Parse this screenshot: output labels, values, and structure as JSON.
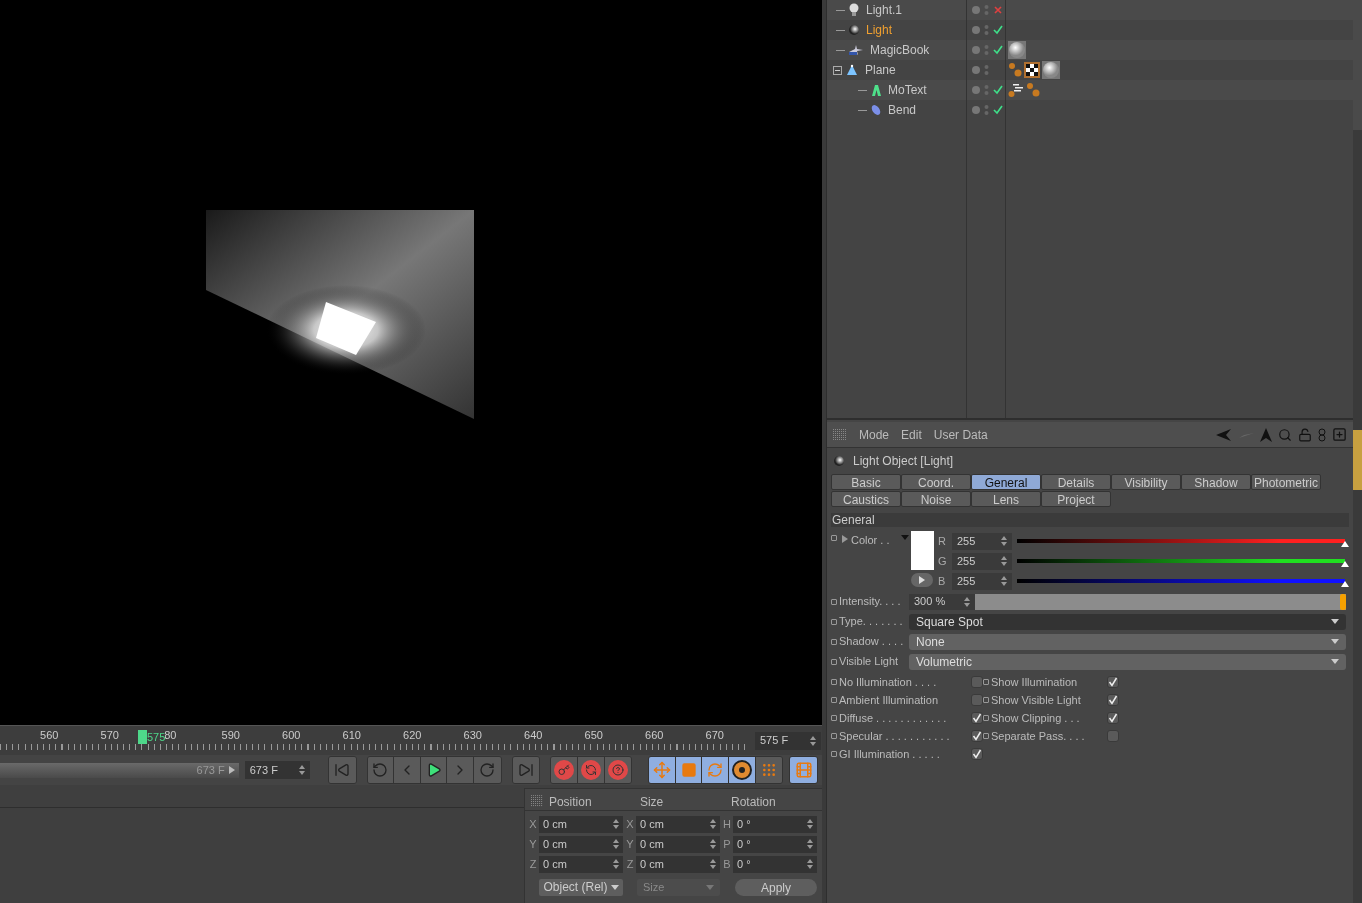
{
  "objects": [
    {
      "name": "Light.1",
      "kind": "bulb",
      "active": false,
      "enabled": false
    },
    {
      "name": "Light",
      "kind": "spot",
      "active": true,
      "enabled": true
    },
    {
      "name": "MagicBook",
      "kind": "figure",
      "active": false,
      "enabled": true,
      "tags": [
        {
          "kind": "material"
        }
      ]
    },
    {
      "name": "Plane",
      "kind": "plane",
      "active": false,
      "expanded": true,
      "tags": [
        {
          "kind": "dots"
        },
        {
          "kind": "checker"
        },
        {
          "kind": "material"
        }
      ],
      "children": [
        {
          "name": "MoText",
          "kind": "motext",
          "active": false,
          "enabled": true,
          "tags": [
            {
              "kind": "lines"
            },
            {
              "kind": "dots"
            }
          ]
        },
        {
          "name": "Bend",
          "kind": "bend",
          "active": false,
          "enabled": true
        }
      ]
    }
  ],
  "attributes": {
    "menu": [
      "Mode",
      "Edit",
      "User Data"
    ],
    "title": "Light Object [Light]",
    "tabs": [
      {
        "label": "Basic",
        "selected": false
      },
      {
        "label": "Coord.",
        "selected": false
      },
      {
        "label": "General",
        "selected": true
      },
      {
        "label": "Details",
        "selected": false
      },
      {
        "label": "Visibility",
        "selected": false
      },
      {
        "label": "Shadow",
        "selected": false
      },
      {
        "label": "Photometric",
        "selected": false
      },
      {
        "label": "Caustics",
        "selected": false
      },
      {
        "label": "Noise",
        "selected": false
      },
      {
        "label": "Lens",
        "selected": false
      },
      {
        "label": "Project",
        "selected": false
      }
    ],
    "section": "General",
    "color": {
      "label": "Color . .",
      "channels": [
        {
          "name": "R",
          "value": "255",
          "level": 1,
          "color": "#ff2020"
        },
        {
          "name": "G",
          "value": "255",
          "level": 1,
          "color": "#20e020"
        },
        {
          "name": "B",
          "value": "255",
          "level": 1,
          "color": "#1010ff"
        }
      ]
    },
    "params": [
      {
        "kind": "slider",
        "label": "Intensity. . . .",
        "value": "300 %",
        "level": 1
      },
      {
        "kind": "dropdown",
        "label": "Type. . . . . . .",
        "value": "Square Spot",
        "focused": true
      },
      {
        "kind": "dropdown",
        "label": "Shadow . . . .",
        "value": "None",
        "focused": false
      },
      {
        "kind": "dropdown",
        "label": "Visible Light",
        "value": "Volumetric",
        "focused": false
      }
    ],
    "options_left": [
      {
        "label": "No Illumination . . . .",
        "checked": false
      },
      {
        "label": "Ambient Illumination",
        "checked": false
      },
      {
        "label": "Diffuse . . . . . . . . . . . .",
        "checked": true
      },
      {
        "label": "Specular . . . . . . . . . . .",
        "checked": true
      },
      {
        "label": "GI Illumination . . . . .",
        "checked": true
      }
    ],
    "options_right": [
      {
        "label": "Show Illumination",
        "checked": true
      },
      {
        "label": "Show Visible Light",
        "checked": true
      },
      {
        "label": "Show Clipping . . .",
        "checked": true
      },
      {
        "label": "Separate Pass. . . .",
        "checked": false
      }
    ]
  },
  "timeline": {
    "ticks": [
      "560",
      "570",
      "80",
      "590",
      "600",
      "610",
      "620",
      "630",
      "640",
      "650",
      "660",
      "670"
    ],
    "current": "575",
    "frame_field": "575 F",
    "end_bar": "673 F",
    "end_field": "673 F"
  },
  "coordinates": {
    "headers": [
      "Position",
      "Size",
      "Rotation"
    ],
    "columns": [
      [
        {
          "axis": "X",
          "value": "0 cm"
        },
        {
          "axis": "Y",
          "value": "0 cm"
        },
        {
          "axis": "Z",
          "value": "0 cm"
        }
      ],
      [
        {
          "axis": "X",
          "value": "0 cm"
        },
        {
          "axis": "Y",
          "value": "0 cm"
        },
        {
          "axis": "Z",
          "value": "0 cm"
        }
      ],
      [
        {
          "axis": "H",
          "value": "0 °"
        },
        {
          "axis": "P",
          "value": "0 °"
        },
        {
          "axis": "B",
          "value": "0 °"
        }
      ]
    ],
    "mode_dropdown": "Object (Rel)",
    "size_dropdown": {
      "label": "Size",
      "disabled": true
    },
    "apply": "Apply"
  }
}
